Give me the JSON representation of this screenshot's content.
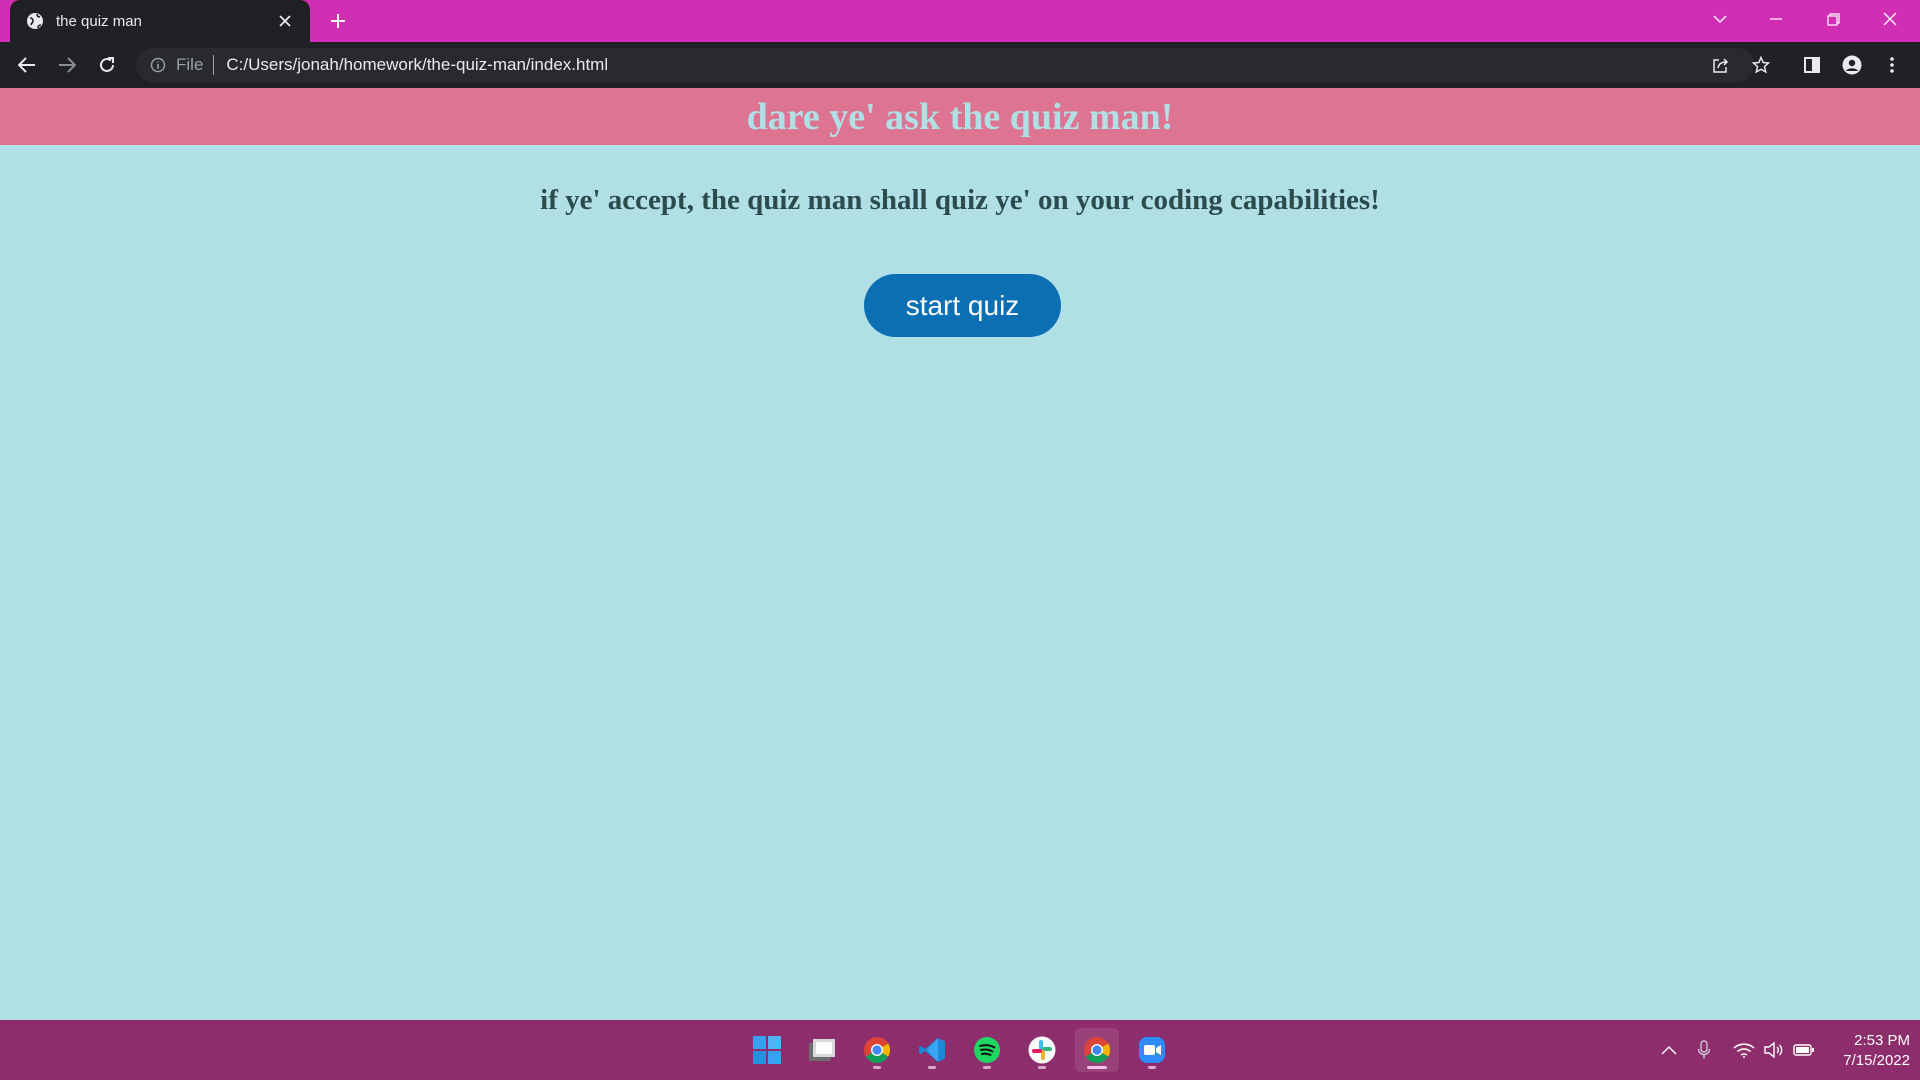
{
  "browser": {
    "tab": {
      "title": "the quiz man",
      "favicon": "globe-icon"
    },
    "address_bar": {
      "scheme_label": "File",
      "url": "C:/Users/jonah/homework/the-quiz-man/index.html"
    }
  },
  "page": {
    "heading": "dare ye' ask the quiz man!",
    "intro": "if ye' accept, the quiz man shall quiz ye' on your coding capabilities!",
    "start_button_label": "start quiz"
  },
  "taskbar": {
    "apps": [
      "windows-start",
      "file-explorer",
      "chrome",
      "visual-studio-code",
      "spotify",
      "slack",
      "chrome-active",
      "zoom"
    ],
    "clock": {
      "time": "2:53 PM",
      "date": "7/15/2022"
    }
  },
  "colors": {
    "tab_strip": "#d12fb3",
    "page_background": "#b0dfe5",
    "header_background": "#dd7592",
    "heading_text": "#b0dfe5",
    "intro_text": "#2b4b4d",
    "button": "#0b6fb4",
    "taskbar": "#8e2d6b"
  }
}
